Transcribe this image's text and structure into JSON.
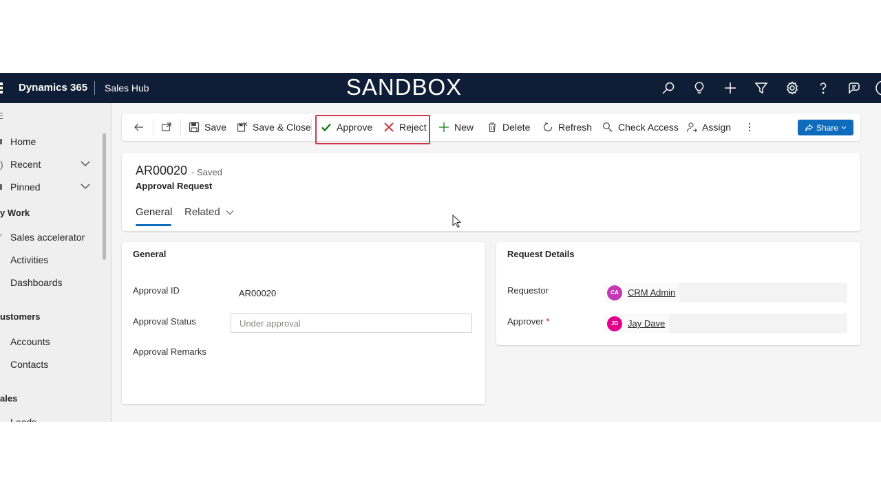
{
  "topbar": {
    "brand": "Dynamics 365",
    "app_name": "Sales Hub",
    "environment_banner": "SANDBOX",
    "icons": [
      "search-icon",
      "lightbulb-icon",
      "plus-icon",
      "filter-icon",
      "gear-icon",
      "help-icon",
      "feedback-icon"
    ]
  },
  "sidebar": {
    "items": [
      {
        "label": "Home"
      },
      {
        "label": "Recent"
      },
      {
        "label": "Pinned"
      }
    ],
    "groups": [
      {
        "title": "y Work",
        "items": [
          "Sales accelerator",
          "Activities",
          "Dashboards"
        ]
      },
      {
        "title": "ustomers",
        "items": [
          "Accounts",
          "Contacts"
        ]
      },
      {
        "title": "ales",
        "items": [
          "Leads"
        ]
      }
    ]
  },
  "commandbar": {
    "save": "Save",
    "save_close": "Save & Close",
    "approve": "Approve",
    "reject": "Reject",
    "new": "New",
    "delete": "Delete",
    "refresh": "Refresh",
    "check_access": "Check Access",
    "assign": "Assign",
    "share": "Share"
  },
  "record": {
    "title": "AR00020",
    "status": "- Saved",
    "entity": "Approval Request",
    "tabs": [
      "General",
      "Related"
    ]
  },
  "general_section": {
    "title": "General",
    "approval_id_label": "Approval ID",
    "approval_id_value": "AR00020",
    "approval_status_label": "Approval Status",
    "approval_status_placeholder": "Under approval",
    "approval_remarks_label": "Approval Remarks"
  },
  "request_details": {
    "title": "Request Details",
    "requestor_label": "Requestor",
    "requestor_initials": "CA",
    "requestor_name": "CRM Admin",
    "approver_label": "Approver",
    "approver_required": "*",
    "approver_initials": "JD",
    "approver_name": "Jay Dave"
  },
  "colors": {
    "topbar": "#0f1d36",
    "primary": "#0f6cbd",
    "highlight": "#d13448",
    "approve_check": "#107c10",
    "reject_x": "#d13438",
    "avatar_ca": "#c239b3",
    "avatar_jd": "#e3008c"
  }
}
